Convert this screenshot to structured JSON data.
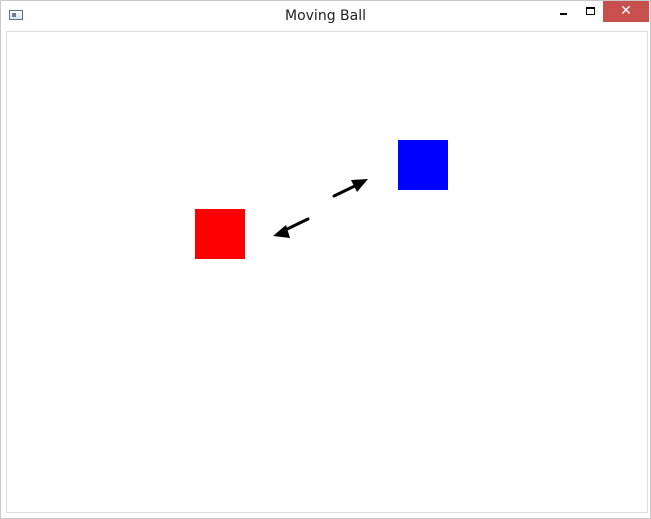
{
  "window": {
    "title": "Moving Ball",
    "icon": "window-app-icon"
  },
  "controls": {
    "minimize_icon": "minimize-icon",
    "maximize_icon": "maximize-icon",
    "close_label": "✕",
    "close_color": "#c7504f"
  },
  "canvas": {
    "background_color": "#ffffff",
    "shapes": [
      {
        "name": "red-square",
        "color": "#ff0000"
      },
      {
        "name": "blue-square",
        "color": "#0000ff"
      }
    ],
    "arrows": [
      {
        "name": "arrow-up-right-icon",
        "color": "#000000"
      },
      {
        "name": "arrow-down-left-icon",
        "color": "#000000"
      }
    ]
  }
}
